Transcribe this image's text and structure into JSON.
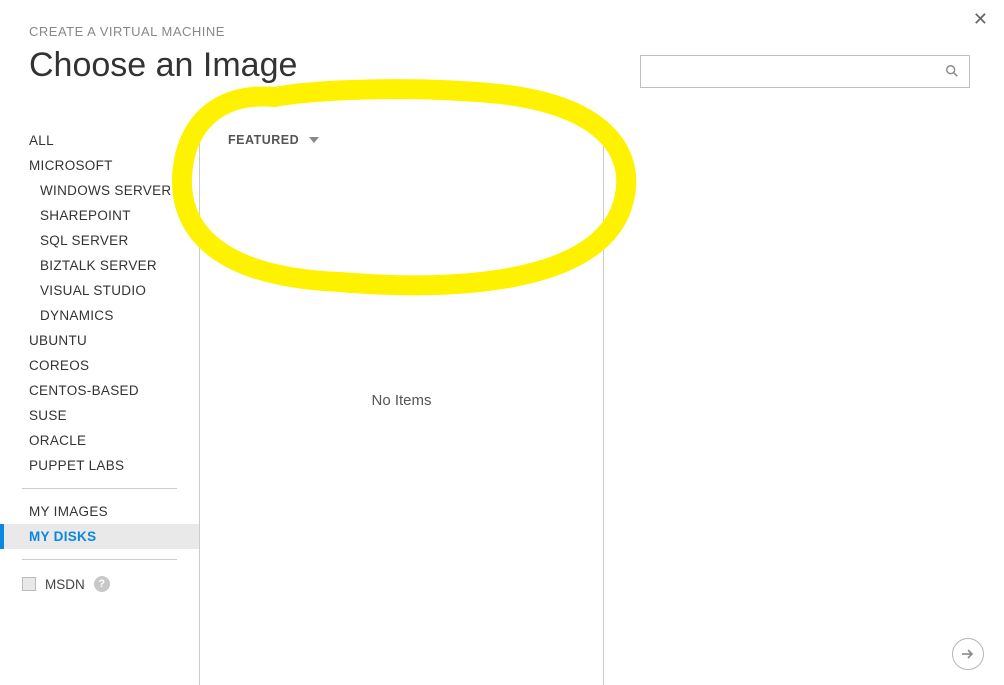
{
  "header": {
    "breadcrumb": "CREATE A VIRTUAL MACHINE",
    "title": "Choose an Image"
  },
  "search": {
    "placeholder": ""
  },
  "sidebar": {
    "items": [
      {
        "label": "ALL",
        "sub": false,
        "selected": false
      },
      {
        "label": "MICROSOFT",
        "sub": false,
        "selected": false
      },
      {
        "label": "WINDOWS SERVER",
        "sub": true,
        "selected": false
      },
      {
        "label": "SHAREPOINT",
        "sub": true,
        "selected": false
      },
      {
        "label": "SQL SERVER",
        "sub": true,
        "selected": false
      },
      {
        "label": "BIZTALK SERVER",
        "sub": true,
        "selected": false
      },
      {
        "label": "VISUAL STUDIO",
        "sub": true,
        "selected": false
      },
      {
        "label": "DYNAMICS",
        "sub": true,
        "selected": false
      },
      {
        "label": "UBUNTU",
        "sub": false,
        "selected": false
      },
      {
        "label": "COREOS",
        "sub": false,
        "selected": false
      },
      {
        "label": "CENTOS-BASED",
        "sub": false,
        "selected": false
      },
      {
        "label": "SUSE",
        "sub": false,
        "selected": false
      },
      {
        "label": "ORACLE",
        "sub": false,
        "selected": false
      },
      {
        "label": "PUPPET LABS",
        "sub": false,
        "selected": false
      }
    ],
    "user_items": [
      {
        "label": "MY IMAGES",
        "selected": false
      },
      {
        "label": "MY DISKS",
        "selected": true
      }
    ],
    "msdn_label": "MSDN"
  },
  "content": {
    "sort_label": "FEATURED",
    "empty_text": "No Items"
  },
  "annotation": {
    "type": "freehand-circle",
    "color": "#fff200"
  }
}
